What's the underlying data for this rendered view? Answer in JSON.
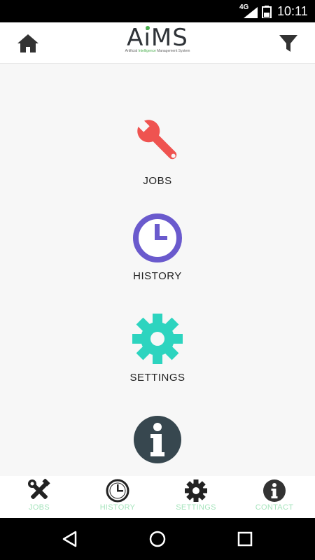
{
  "status_bar": {
    "network": "4G",
    "time": "10:11"
  },
  "app_bar": {
    "logo_text_a": "A",
    "logo_text_i": "i",
    "logo_text_ms": "MS",
    "logo_tag_1": "Artificial ",
    "logo_tag_2": "Intelligence",
    "logo_tag_3": " Management System",
    "home_icon": "home-icon",
    "filter_icon": "filter-icon"
  },
  "menu": {
    "items": [
      {
        "label": "JOBS",
        "icon": "wrench-icon",
        "color": "#ef5350"
      },
      {
        "label": "HISTORY",
        "icon": "clock-icon",
        "color": "#6a5acd"
      },
      {
        "label": "SETTINGS",
        "icon": "gear-icon",
        "color": "#2dd4bf"
      },
      {
        "label": "",
        "icon": "info-icon",
        "color": "#37474f"
      }
    ]
  },
  "bottom_nav": {
    "items": [
      {
        "label": "JOBS",
        "icon": "tools-icon"
      },
      {
        "label": "HISTORY",
        "icon": "clock-icon"
      },
      {
        "label": "SETTINGS",
        "icon": "gear-icon"
      },
      {
        "label": "CONTACT",
        "icon": "info-icon"
      }
    ],
    "label_color": "#a7e4bd"
  },
  "system_nav": {
    "back": "back-icon",
    "home": "home-circle-icon",
    "recents": "recents-icon"
  }
}
